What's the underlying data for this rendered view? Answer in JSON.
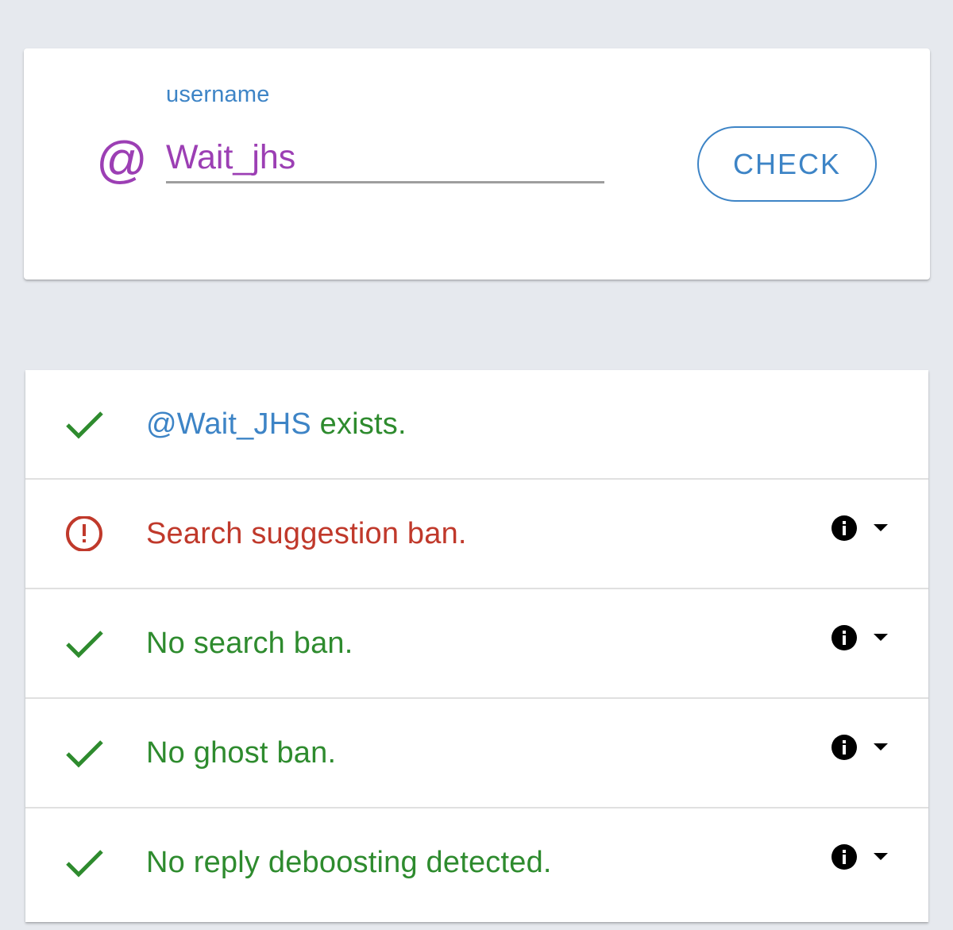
{
  "search_form": {
    "label": "username",
    "at_symbol": "@",
    "value": "Wait_jhs",
    "check_label": "CHECK"
  },
  "results": {
    "exists": {
      "handle": "@Wait_JHS",
      "suffix": " exists.",
      "status": "ok"
    },
    "items": [
      {
        "text": "Search suggestion ban.",
        "status": "ban"
      },
      {
        "text": "No search ban.",
        "status": "ok"
      },
      {
        "text": "No ghost ban.",
        "status": "ok"
      },
      {
        "text": "No reply deboosting detected.",
        "status": "ok"
      }
    ]
  },
  "icons": {
    "ok": "check-icon",
    "ban": "alert-circle-icon",
    "info": "info-icon",
    "dropdown": "caret-down-icon"
  },
  "colors": {
    "accent_blue": "#3d84c6",
    "accent_purple": "#9c3fb4",
    "ok_green": "#2e8b2e",
    "ban_red": "#c0392b",
    "background": "#e6e9ee"
  }
}
